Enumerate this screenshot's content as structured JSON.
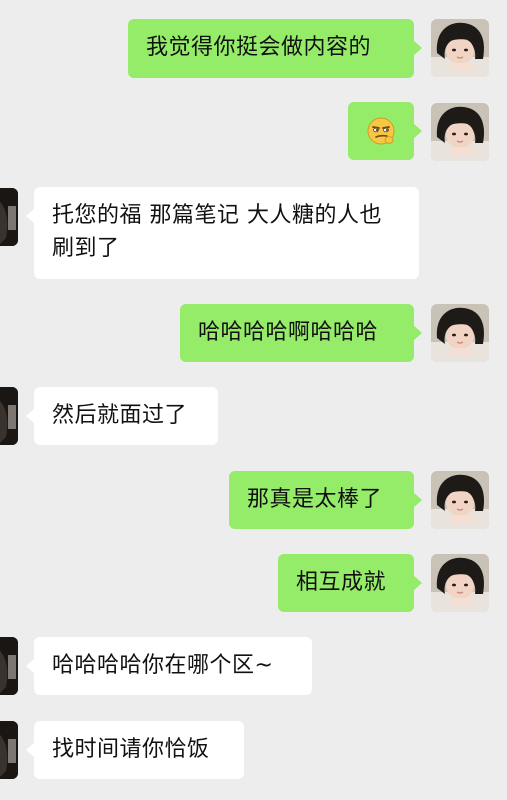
{
  "messages": [
    {
      "side": "me",
      "text": "我觉得你挺会做内容的"
    },
    {
      "side": "me",
      "emoji": "smirk-face-emoji"
    },
    {
      "side": "other",
      "text": "托您的福  那篇笔记  大人糖的人也刷到了"
    },
    {
      "side": "me",
      "text": "哈哈哈哈啊哈哈哈"
    },
    {
      "side": "other",
      "text": "然后就面过了"
    },
    {
      "side": "me",
      "text": "那真是太棒了"
    },
    {
      "side": "me",
      "text": "相互成就"
    },
    {
      "side": "other",
      "text": "哈哈哈哈你在哪个区~"
    },
    {
      "side": "other",
      "text": "找时间请你恰饭"
    }
  ],
  "colors": {
    "background": "#ededed",
    "my_bubble": "#95ec69",
    "other_bubble": "#ffffff"
  },
  "icons": {
    "my_avatar": "girl-photo-avatar",
    "other_avatar": "dark-hair-photo-avatar"
  }
}
